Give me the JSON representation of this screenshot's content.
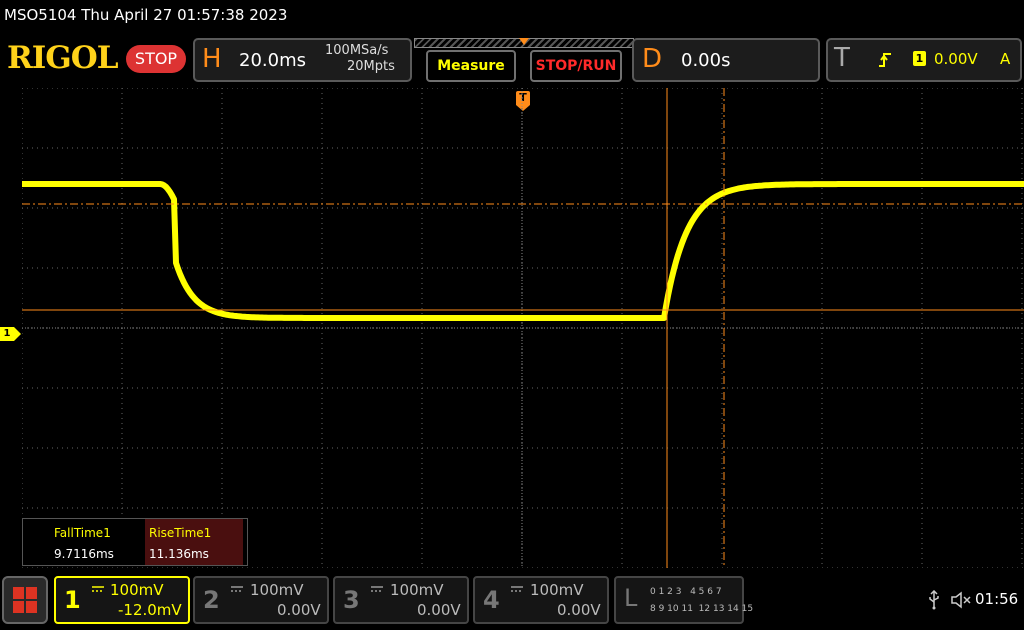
{
  "status_bar": {
    "title": "MSO5104  Thu April 27 01:57:38 2023"
  },
  "brand": {
    "logo": "RIGOL",
    "run_state": "STOP"
  },
  "horizontal": {
    "letter": "H",
    "timebase": "20.0ms",
    "sample_rate": "100MSa/s",
    "memory_depth": "20Mpts"
  },
  "buttons": {
    "measure": "Measure",
    "stop_run": "STOP/RUN"
  },
  "delay": {
    "letter": "D",
    "value": "0.00s"
  },
  "trigger": {
    "letter": "T",
    "source": "1",
    "level": "0.00V",
    "mode": "A",
    "marker": "T"
  },
  "channel_marker": "1",
  "measurements": [
    {
      "name": "FallTime1",
      "value": "9.7116ms"
    },
    {
      "name": "RiseTime1",
      "value": "11.136ms"
    }
  ],
  "channels": [
    {
      "num": "1",
      "scale": "100mV",
      "offset": "-12.0mV"
    },
    {
      "num": "2",
      "scale": "100mV",
      "offset": "0.00V"
    },
    {
      "num": "3",
      "scale": "100mV",
      "offset": "0.00V"
    },
    {
      "num": "4",
      "scale": "100mV",
      "offset": "0.00V"
    }
  ],
  "logic": {
    "letter": "L",
    "row1": "0 1 2 3   4 5 6 7",
    "row2": "8 9 10 11  12 13 14 15"
  },
  "system": {
    "time": "01:56"
  },
  "colors": {
    "ch1": "#ffff00",
    "accent": "#ff8c1a",
    "cursor": "#ff8c1a"
  }
}
